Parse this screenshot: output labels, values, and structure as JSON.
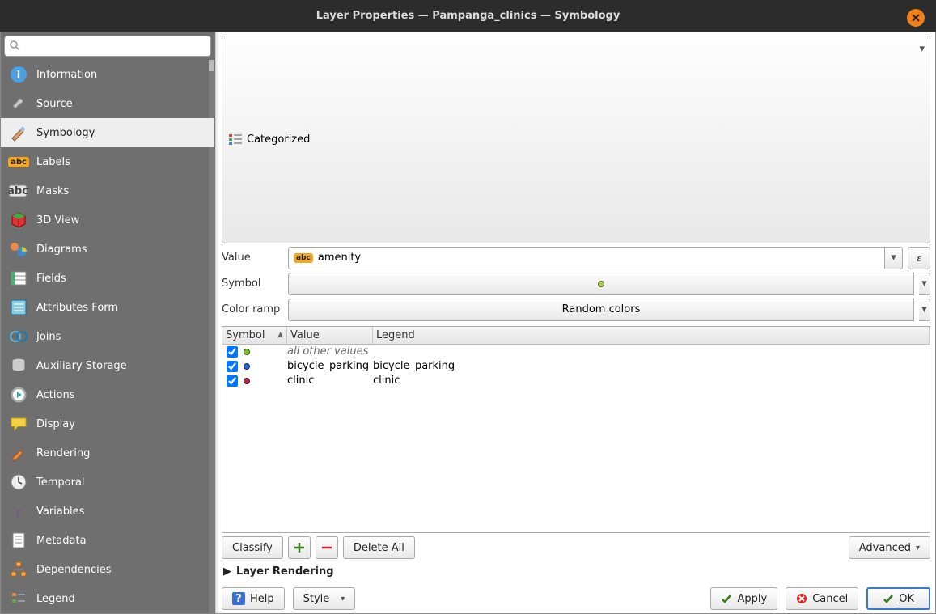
{
  "title": "Layer Properties — Pampanga_clinics — Symbology",
  "search": {
    "placeholder": ""
  },
  "nav": {
    "items": [
      {
        "label": "Information"
      },
      {
        "label": "Source"
      },
      {
        "label": "Symbology"
      },
      {
        "label": "Labels"
      },
      {
        "label": "Masks"
      },
      {
        "label": "3D View"
      },
      {
        "label": "Diagrams"
      },
      {
        "label": "Fields"
      },
      {
        "label": "Attributes Form"
      },
      {
        "label": "Joins"
      },
      {
        "label": "Auxiliary Storage"
      },
      {
        "label": "Actions"
      },
      {
        "label": "Display"
      },
      {
        "label": "Rendering"
      },
      {
        "label": "Temporal"
      },
      {
        "label": "Variables"
      },
      {
        "label": "Metadata"
      },
      {
        "label": "Dependencies"
      },
      {
        "label": "Legend"
      }
    ],
    "active_index": 2
  },
  "renderer": "Categorized",
  "field_row_label": "Value",
  "field_prefix": "abc",
  "field_value": "amenity",
  "symbol_row_label": "Symbol",
  "ramp_row_label": "Color ramp",
  "ramp_value": "Random colors",
  "table": {
    "headers": {
      "symbol": "Symbol",
      "value": "Value",
      "legend": "Legend"
    },
    "rows": [
      {
        "checked": true,
        "color": "#79c32a",
        "value": "",
        "value_italic": "all other values",
        "legend": ""
      },
      {
        "checked": true,
        "color": "#2f5fd6",
        "value": "bicycle_parking",
        "legend": "bicycle_parking"
      },
      {
        "checked": true,
        "color": "#b12843",
        "value": "clinic",
        "legend": "clinic"
      }
    ]
  },
  "buttons": {
    "classify": "Classify",
    "delete_all": "Delete All",
    "advanced": "Advanced"
  },
  "section": "Layer Rendering",
  "footer": {
    "help": "Help",
    "style": "Style",
    "apply": "Apply",
    "cancel": "Cancel",
    "ok": "OK"
  }
}
